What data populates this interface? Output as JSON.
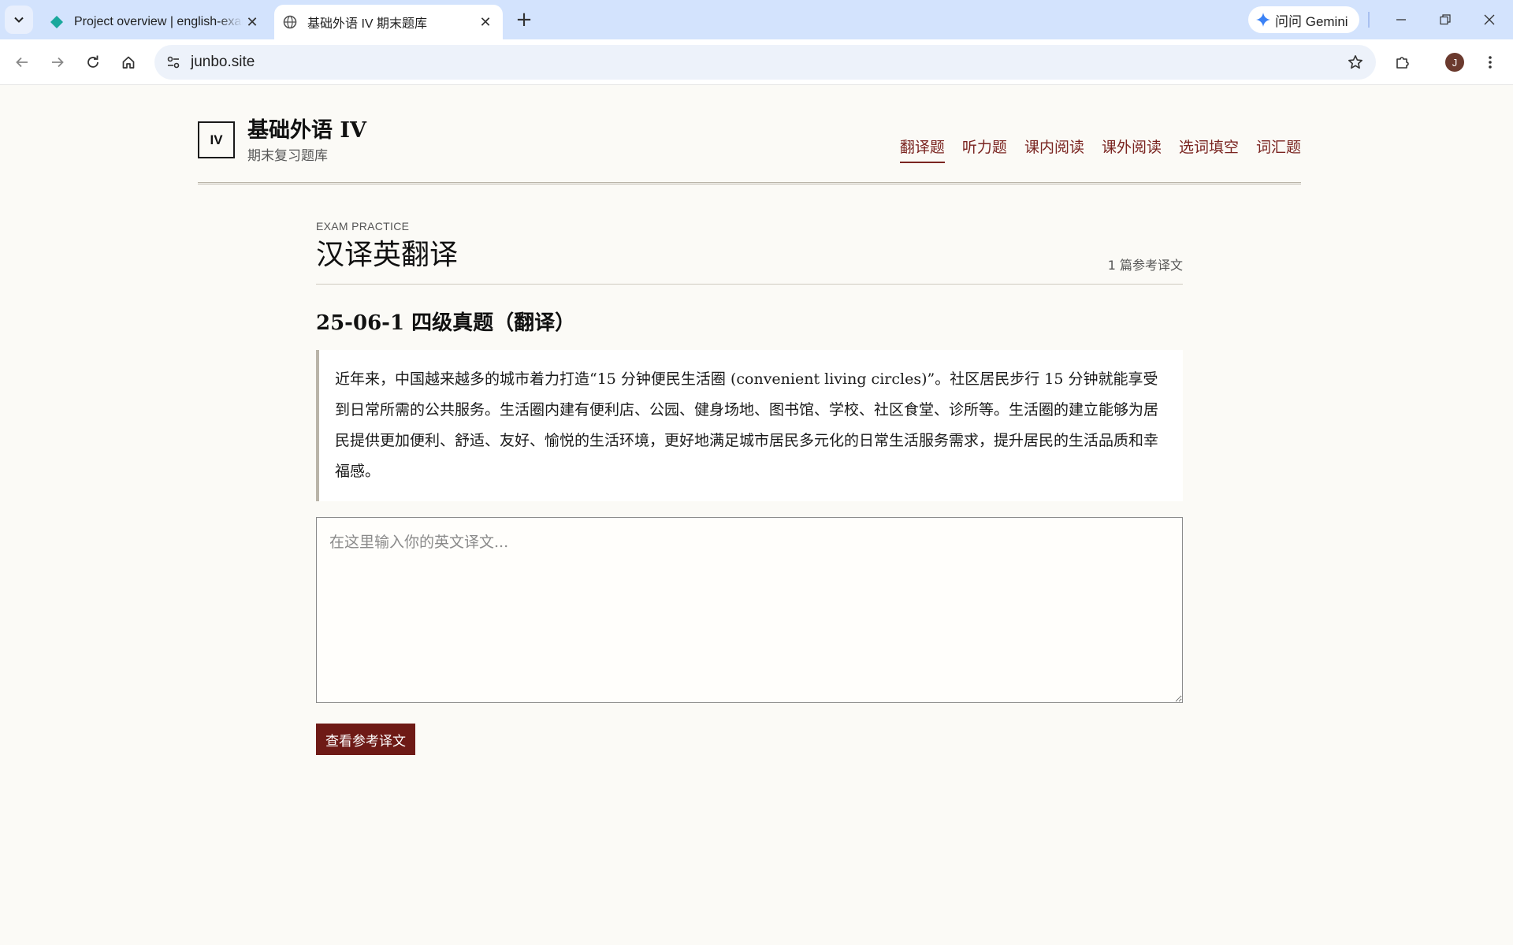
{
  "browser": {
    "tabs": [
      {
        "title": "Project overview | english-exam",
        "active": false
      },
      {
        "title": "基础外语 IV 期末题库",
        "active": true
      }
    ],
    "gemini_label": "问问 Gemini",
    "url": "junbo.site",
    "profile_initial": "J"
  },
  "site": {
    "logo": "IV",
    "title": "基础外语 IV",
    "subtitle": "期末复习题库",
    "nav": [
      "翻译题",
      "听力题",
      "课内阅读",
      "课外阅读",
      "选词填空",
      "词汇题"
    ],
    "active_nav": "翻译题"
  },
  "page": {
    "eyebrow": "EXAM PRACTICE",
    "title": "汉译英翻译",
    "ref_count": "1 篇参考译文"
  },
  "question": {
    "title": "25-06-1 四级真题（翻译）",
    "prompt": "近年来，中国越来越多的城市着力打造“15 分钟便民生活圈 (convenient living circles)”。社区居民步行 15 分钟就能享受到日常所需的公共服务。生活圈内建有便利店、公园、健身场地、图书馆、学校、社区食堂、诊所等。生活圈的建立能够为居民提供更加便利、舒适、友好、愉悦的生活环境，更好地满足城市居民多元化的日常生活服务需求，提升居民的生活品质和幸福感。",
    "answer_placeholder": "在这里输入你的英文译文...",
    "answer_value": "",
    "show_button": "查看参考译文"
  },
  "colors": {
    "accent": "#7a2420",
    "button": "#6e1a16",
    "page_bg": "#fbfaf6",
    "tabstrip": "#d3e3fd"
  }
}
